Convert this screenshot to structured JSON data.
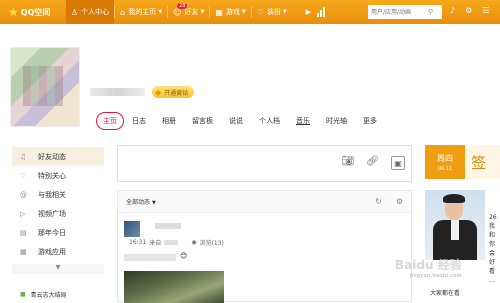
{
  "topbar": {
    "logo": "QQ空间",
    "nav": [
      {
        "label": "个人中心",
        "icon": "user-icon"
      },
      {
        "label": "我的主页",
        "icon": "home-icon"
      },
      {
        "label": "好友",
        "icon": "friends-icon",
        "badge": "28"
      },
      {
        "label": "游戏",
        "icon": "game-icon"
      },
      {
        "label": "装扮",
        "icon": "dress-icon"
      }
    ],
    "search_placeholder": "用户/应用/动画"
  },
  "profile": {
    "vip_button": "开通黄钻",
    "tabs": [
      "主页",
      "日志",
      "相册",
      "留言板",
      "说说",
      "个人档",
      "音乐",
      "时光轴",
      "更多"
    ]
  },
  "sidebar": {
    "items": [
      {
        "label": "好友动态",
        "icon": "bell-icon"
      },
      {
        "label": "特别关心",
        "icon": "heart-icon"
      },
      {
        "label": "与我相关",
        "icon": "at-icon"
      },
      {
        "label": "视频广场",
        "icon": "video-icon"
      },
      {
        "label": "那年今日",
        "icon": "calendar-icon"
      },
      {
        "label": "游戏应用",
        "icon": "apps-icon"
      }
    ],
    "bottom_label": "青云志大结局"
  },
  "feed": {
    "filter": "全部动态",
    "post": {
      "time": "16:31",
      "source_prefix": "来自",
      "views": "浏览(13)",
      "emoji": "😊"
    }
  },
  "right": {
    "day": "周四",
    "date": "09.11",
    "sign": "签",
    "ad_lines": [
      "26",
      "我和你",
      "会好看",
      "..."
    ],
    "caption": "大家都在看",
    "caption2": "Baidu"
  },
  "watermark": {
    "main": "Baidu 经验",
    "sub": "jingyan.baidu.com"
  }
}
